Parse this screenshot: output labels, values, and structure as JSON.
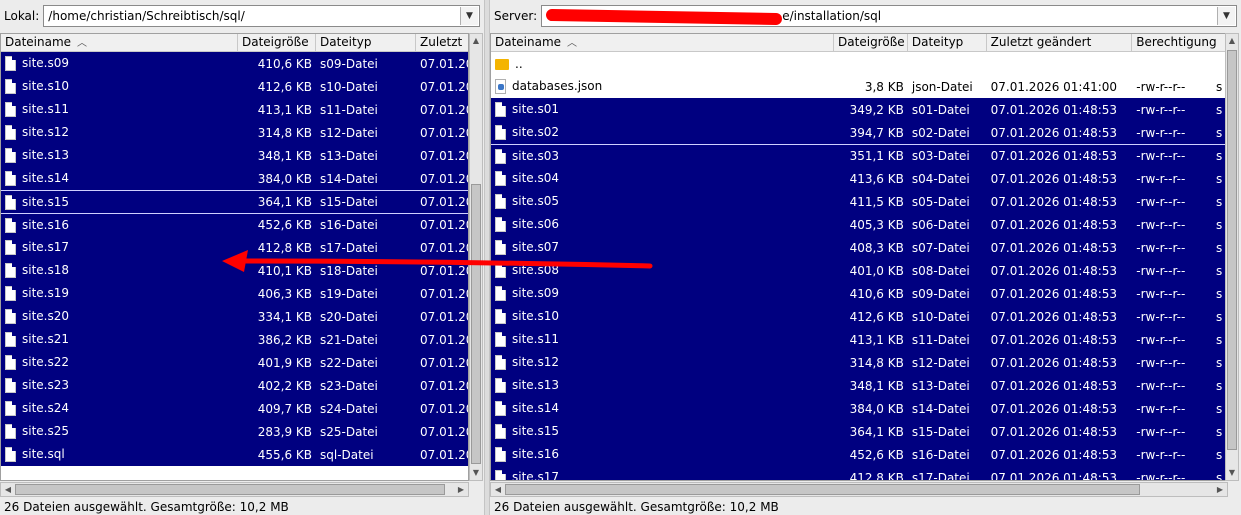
{
  "local": {
    "label": "Lokal:",
    "path": "/home/christian/Schreibtisch/sql/",
    "columns": [
      "Dateiname",
      "Dateigröße",
      "Dateityp",
      "Zuletzt"
    ],
    "rows": [
      {
        "name": "site.s09",
        "size": "410,6 KB",
        "type": "s09-Datei",
        "date": "07.01.20",
        "icon": "file-icon",
        "selected": true
      },
      {
        "name": "site.s10",
        "size": "412,6 KB",
        "type": "s10-Datei",
        "date": "07.01.20",
        "icon": "file-icon",
        "selected": true
      },
      {
        "name": "site.s11",
        "size": "413,1 KB",
        "type": "s11-Datei",
        "date": "07.01.20",
        "icon": "file-icon",
        "selected": true
      },
      {
        "name": "site.s12",
        "size": "314,8 KB",
        "type": "s12-Datei",
        "date": "07.01.20",
        "icon": "file-icon",
        "selected": true
      },
      {
        "name": "site.s13",
        "size": "348,1 KB",
        "type": "s13-Datei",
        "date": "07.01.20",
        "icon": "file-icon",
        "selected": true
      },
      {
        "name": "site.s14",
        "size": "384,0 KB",
        "type": "s14-Datei",
        "date": "07.01.20",
        "icon": "file-icon",
        "selected": true
      },
      {
        "name": "site.s15",
        "size": "364,1 KB",
        "type": "s15-Datei",
        "date": "07.01.20",
        "icon": "file-icon",
        "selected": true
      },
      {
        "name": "site.s16",
        "size": "452,6 KB",
        "type": "s16-Datei",
        "date": "07.01.20",
        "icon": "file-icon",
        "selected": true
      },
      {
        "name": "site.s17",
        "size": "412,8 KB",
        "type": "s17-Datei",
        "date": "07.01.20",
        "icon": "file-icon",
        "selected": true
      },
      {
        "name": "site.s18",
        "size": "410,1 KB",
        "type": "s18-Datei",
        "date": "07.01.20",
        "icon": "file-icon",
        "selected": true
      },
      {
        "name": "site.s19",
        "size": "406,3 KB",
        "type": "s19-Datei",
        "date": "07.01.20",
        "icon": "file-icon",
        "selected": true
      },
      {
        "name": "site.s20",
        "size": "334,1 KB",
        "type": "s20-Datei",
        "date": "07.01.20",
        "icon": "file-icon",
        "selected": true
      },
      {
        "name": "site.s21",
        "size": "386,2 KB",
        "type": "s21-Datei",
        "date": "07.01.20",
        "icon": "file-icon",
        "selected": true
      },
      {
        "name": "site.s22",
        "size": "401,9 KB",
        "type": "s22-Datei",
        "date": "07.01.20",
        "icon": "file-icon",
        "selected": true
      },
      {
        "name": "site.s23",
        "size": "402,2 KB",
        "type": "s23-Datei",
        "date": "07.01.20",
        "icon": "file-icon",
        "selected": true
      },
      {
        "name": "site.s24",
        "size": "409,7 KB",
        "type": "s24-Datei",
        "date": "07.01.20",
        "icon": "file-icon",
        "selected": true
      },
      {
        "name": "site.s25",
        "size": "283,9 KB",
        "type": "s25-Datei",
        "date": "07.01.20",
        "icon": "file-icon",
        "selected": true
      },
      {
        "name": "site.sql",
        "size": "455,6 KB",
        "type": "sql-Datei",
        "date": "07.01.20",
        "icon": "file-icon",
        "selected": true
      }
    ],
    "status": "26 Dateien ausgewählt. Gesamtgröße: 10,2 MB"
  },
  "remote": {
    "label": "Server:",
    "path_visible": "e/installation/sql",
    "columns": [
      "Dateiname",
      "Dateigröße",
      "Dateityp",
      "Zuletzt geändert",
      "Berechtigung"
    ],
    "rows": [
      {
        "name": "..",
        "size": "",
        "type": "",
        "date": "",
        "perm": "",
        "extra": "",
        "icon": "folder-icon",
        "selected": false
      },
      {
        "name": "databases.json",
        "size": "3,8 KB",
        "type": "json-Datei",
        "date": "07.01.2026 01:41:00",
        "perm": "-rw-r--r--",
        "extra": "s",
        "icon": "json-file-icon",
        "selected": false
      },
      {
        "name": "site.s01",
        "size": "349,2 KB",
        "type": "s01-Datei",
        "date": "07.01.2026 01:48:53",
        "perm": "-rw-r--r--",
        "extra": "s",
        "icon": "file-icon",
        "selected": true
      },
      {
        "name": "site.s02",
        "size": "394,7 KB",
        "type": "s02-Datei",
        "date": "07.01.2026 01:48:53",
        "perm": "-rw-r--r--",
        "extra": "s",
        "icon": "file-icon",
        "selected": true
      },
      {
        "name": "site.s03",
        "size": "351,1 KB",
        "type": "s03-Datei",
        "date": "07.01.2026 01:48:53",
        "perm": "-rw-r--r--",
        "extra": "s",
        "icon": "file-icon",
        "selected": true
      },
      {
        "name": "site.s04",
        "size": "413,6 KB",
        "type": "s04-Datei",
        "date": "07.01.2026 01:48:53",
        "perm": "-rw-r--r--",
        "extra": "s",
        "icon": "file-icon",
        "selected": true
      },
      {
        "name": "site.s05",
        "size": "411,5 KB",
        "type": "s05-Datei",
        "date": "07.01.2026 01:48:53",
        "perm": "-rw-r--r--",
        "extra": "s",
        "icon": "file-icon",
        "selected": true
      },
      {
        "name": "site.s06",
        "size": "405,3 KB",
        "type": "s06-Datei",
        "date": "07.01.2026 01:48:53",
        "perm": "-rw-r--r--",
        "extra": "s",
        "icon": "file-icon",
        "selected": true
      },
      {
        "name": "site.s07",
        "size": "408,3 KB",
        "type": "s07-Datei",
        "date": "07.01.2026 01:48:53",
        "perm": "-rw-r--r--",
        "extra": "s",
        "icon": "file-icon",
        "selected": true
      },
      {
        "name": "site.s08",
        "size": "401,0 KB",
        "type": "s08-Datei",
        "date": "07.01.2026 01:48:53",
        "perm": "-rw-r--r--",
        "extra": "s",
        "icon": "file-icon",
        "selected": true
      },
      {
        "name": "site.s09",
        "size": "410,6 KB",
        "type": "s09-Datei",
        "date": "07.01.2026 01:48:53",
        "perm": "-rw-r--r--",
        "extra": "s",
        "icon": "file-icon",
        "selected": true
      },
      {
        "name": "site.s10",
        "size": "412,6 KB",
        "type": "s10-Datei",
        "date": "07.01.2026 01:48:53",
        "perm": "-rw-r--r--",
        "extra": "s",
        "icon": "file-icon",
        "selected": true
      },
      {
        "name": "site.s11",
        "size": "413,1 KB",
        "type": "s11-Datei",
        "date": "07.01.2026 01:48:53",
        "perm": "-rw-r--r--",
        "extra": "s",
        "icon": "file-icon",
        "selected": true
      },
      {
        "name": "site.s12",
        "size": "314,8 KB",
        "type": "s12-Datei",
        "date": "07.01.2026 01:48:53",
        "perm": "-rw-r--r--",
        "extra": "s",
        "icon": "file-icon",
        "selected": true
      },
      {
        "name": "site.s13",
        "size": "348,1 KB",
        "type": "s13-Datei",
        "date": "07.01.2026 01:48:53",
        "perm": "-rw-r--r--",
        "extra": "s",
        "icon": "file-icon",
        "selected": true
      },
      {
        "name": "site.s14",
        "size": "384,0 KB",
        "type": "s14-Datei",
        "date": "07.01.2026 01:48:53",
        "perm": "-rw-r--r--",
        "extra": "s",
        "icon": "file-icon",
        "selected": true
      },
      {
        "name": "site.s15",
        "size": "364,1 KB",
        "type": "s15-Datei",
        "date": "07.01.2026 01:48:53",
        "perm": "-rw-r--r--",
        "extra": "s",
        "icon": "file-icon",
        "selected": true
      },
      {
        "name": "site.s16",
        "size": "452,6 KB",
        "type": "s16-Datei",
        "date": "07.01.2026 01:48:53",
        "perm": "-rw-r--r--",
        "extra": "s",
        "icon": "file-icon",
        "selected": true
      },
      {
        "name": "site.s17",
        "size": "412,8 KB",
        "type": "s17-Datei",
        "date": "07.01.2026 01:48:53",
        "perm": "-rw-r--r--",
        "extra": "s",
        "icon": "file-icon",
        "selected": true
      }
    ],
    "status": "26 Dateien ausgewählt. Gesamtgröße: 10,2 MB"
  },
  "colors": {
    "selection": "#000080",
    "annotation_arrow": "#ff0000",
    "redaction": "#ff0000"
  }
}
